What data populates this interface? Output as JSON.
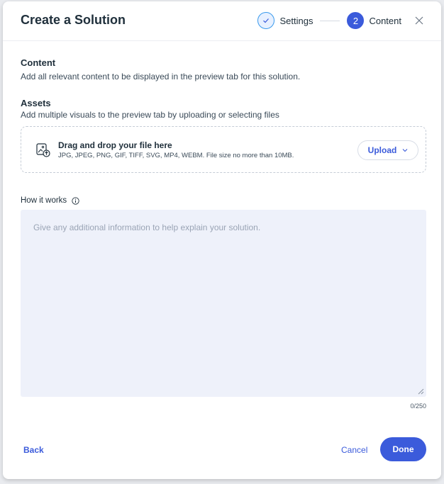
{
  "header": {
    "title": "Create a Solution",
    "steps": [
      {
        "label": "Settings",
        "state": "done",
        "icon": "check-icon"
      },
      {
        "label": "Content",
        "state": "active",
        "number": "2"
      }
    ]
  },
  "content_section": {
    "title": "Content",
    "description": "Add all relevant content to be displayed in the preview tab for this solution."
  },
  "assets_section": {
    "title": "Assets",
    "description": "Add multiple visuals to the preview tab by uploading or selecting files",
    "dropzone": {
      "title": "Drag and drop your file here",
      "subtitle": "JPG, JPEG, PNG, GIF, TIFF, SVG, MP4, WEBM. File size no more than 10MB.",
      "upload_label": "Upload"
    }
  },
  "how_it_works": {
    "label": "How it works",
    "placeholder": "Give any additional information to help explain your solution.",
    "value": "",
    "counter": "0/250"
  },
  "footer": {
    "back_label": "Back",
    "cancel_label": "Cancel",
    "done_label": "Done"
  },
  "colors": {
    "accent": "#3b5bdb",
    "text": "#20303c",
    "textarea_bg": "#eef1fa"
  }
}
